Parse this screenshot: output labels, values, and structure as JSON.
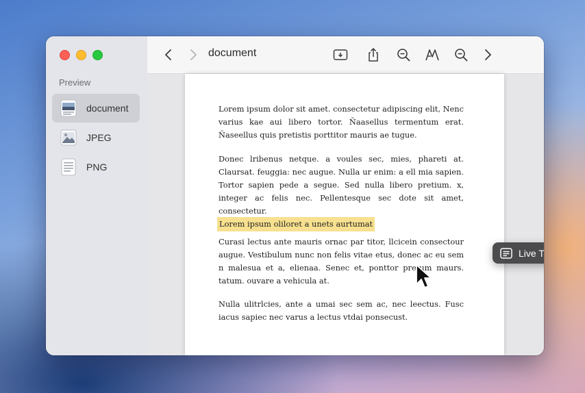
{
  "sidebar": {
    "title": "Preview",
    "items": [
      {
        "label": "document",
        "icon": "document-thumbnail-icon",
        "active": true
      },
      {
        "label": "JPEG",
        "icon": "image-file-icon",
        "active": false
      },
      {
        "label": "PNG",
        "icon": "text-file-icon",
        "active": false
      }
    ]
  },
  "toolbar": {
    "title": "document",
    "buttons": [
      "back-icon",
      "forward-icon",
      "sidebar-toggle-icon",
      "share-icon",
      "zoom-out-icon",
      "markup-icon",
      "zoom-in-icon",
      "next-icon",
      "more-icon"
    ]
  },
  "document": {
    "paragraphs": [
      "Lorem ipsum dolor sit amet. consectetur adipiscing elit, Nenc varius kae aui libero tortor. Ñaasellus termentum erat. Ñaseellus quis pretistis porttitor mauris ae tugue.",
      "Donec lribenus netque. a voules sec, mies, phareti at. Claursat. feuggia: nec augue. Nulla ur enim: a ell mia sapien. Tortor sapien pede a segue. Sed nulla libero pretium. x, integer ac felis nec. Pellentesque sec dote sit amet, consectetur.",
      "Curasi lectus ante mauris ornac par titor, llcicein consectour augue. Vestibulum nunc non felis vitae etus, donec ac eu sem n malesua et a, elienaa. Senec et, ponttor pretum maurs. tatum. ouvare a vehicula at.",
      "Nulla ulitrlcies, ante a umai sec sem ac, nec leectus. Fusc iacus sapiec nec varus a lectus vtdai ponsecust."
    ],
    "highlight": "Lorem ipsum oliloret a unets aurtumat",
    "highlight_color": "#f7e08f"
  },
  "live_text_button": {
    "label": "Live Text",
    "icon": "live-text-icon"
  }
}
